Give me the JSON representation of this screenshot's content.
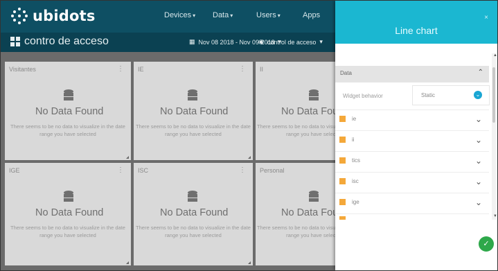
{
  "app": {
    "logo_text": "ubidots"
  },
  "nav": {
    "devices": "Devices",
    "data": "Data",
    "users": "Users",
    "apps": "Apps"
  },
  "dashboard": {
    "title": "contro de acceso",
    "date_range": "Nov 08 2018 - Nov 09 2018",
    "selected_dashboard": "control de acceso"
  },
  "widgets": [
    {
      "title": "Visitantes",
      "empty_title": "No Data Found",
      "empty_message": "There seems to be no data to visualize in the date range you have selected"
    },
    {
      "title": "IE",
      "empty_title": "No Data Found",
      "empty_message": "There seems to be no data to visualize in the date range you have selected"
    },
    {
      "title": "II",
      "empty_title": "No Data Found",
      "empty_message": "There seems to be no data to visualize in the date range you have selected"
    },
    {
      "title": "IGE",
      "empty_title": "No Data Found",
      "empty_message": "There seems to be no data to visualize in the date range you have selected"
    },
    {
      "title": "ISC",
      "empty_title": "No Data Found",
      "empty_message": "There seems to be no data to visualize in the date range you have selected"
    },
    {
      "title": "Personal",
      "empty_title": "No Data Found",
      "empty_message": "There seems to be no data to visualize in the date range you have selected"
    }
  ],
  "panel": {
    "title": "Line chart",
    "close_glyph": "×",
    "section_label": "Data",
    "behavior_label": "Widget behavior",
    "behavior_value": "Static",
    "variables": [
      "ie",
      "ii",
      "tics",
      "isc",
      "ige"
    ],
    "variable_color": "#f4a83a",
    "confirm_glyph": "✓"
  },
  "colors": {
    "navbar": "#0e4f63",
    "panel_header": "#1bb7d1",
    "confirm": "#2ea84a"
  }
}
